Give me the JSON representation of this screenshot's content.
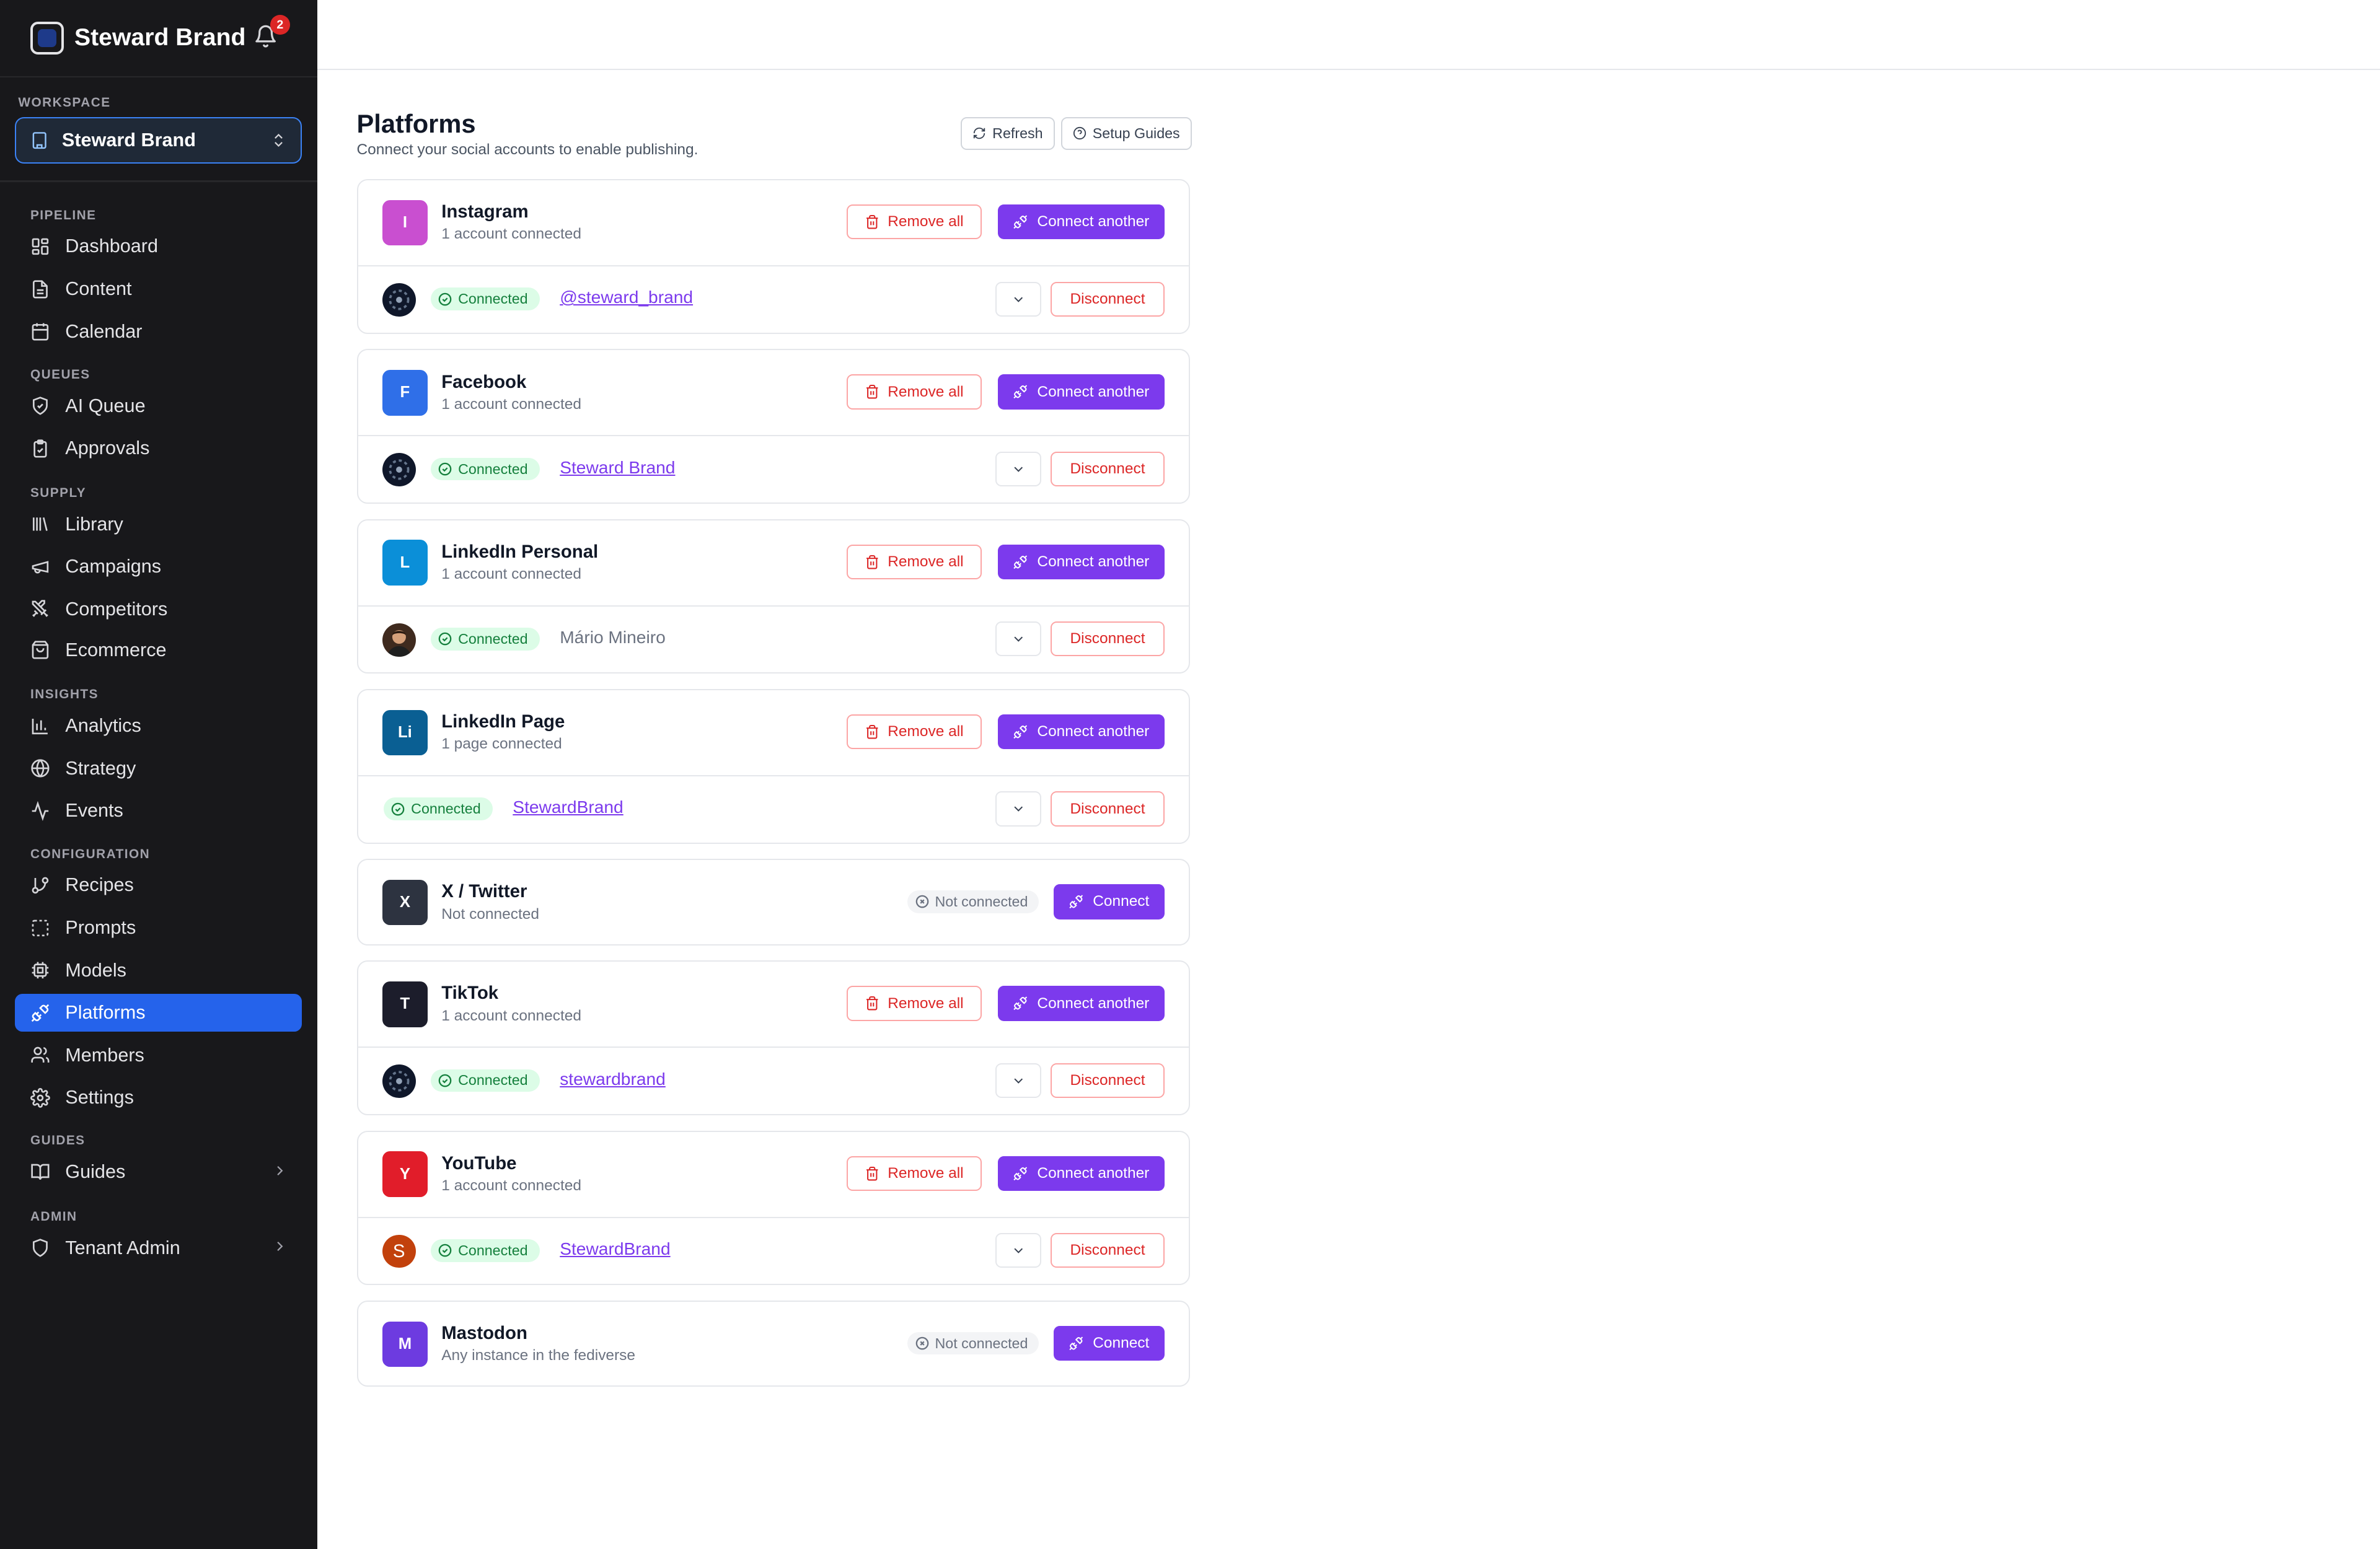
{
  "brand": {
    "name": "Steward Brand",
    "notifications": "2"
  },
  "workspace": {
    "label": "WORKSPACE",
    "name": "Steward Brand"
  },
  "nav": {
    "pipeline": "PIPELINE",
    "dashboard": "Dashboard",
    "content": "Content",
    "calendar": "Calendar",
    "queues": "QUEUES",
    "ai_queue": "AI Queue",
    "approvals": "Approvals",
    "supply": "SUPPLY",
    "library": "Library",
    "campaigns": "Campaigns",
    "competitors": "Competitors",
    "ecommerce": "Ecommerce",
    "insights": "INSIGHTS",
    "analytics": "Analytics",
    "strategy": "Strategy",
    "events": "Events",
    "configuration": "CONFIGURATION",
    "recipes": "Recipes",
    "prompts": "Prompts",
    "models": "Models",
    "platforms": "Platforms",
    "members": "Members",
    "settings": "Settings",
    "guides_section": "GUIDES",
    "guides": "Guides",
    "admin_section": "ADMIN",
    "tenant_admin": "Tenant Admin"
  },
  "header": {
    "title": "Platforms",
    "subtitle": "Connect your social accounts to enable publishing.",
    "refresh": "Refresh",
    "setup_guides": "Setup Guides"
  },
  "labels": {
    "remove_all": "Remove all",
    "connect_another": "Connect another",
    "connect": "Connect",
    "connected": "Connected",
    "not_connected": "Not connected",
    "disconnect": "Disconnect"
  },
  "platforms": [
    {
      "letter": "I",
      "name": "Instagram",
      "status": "1 account connected",
      "color": "#c94fd0",
      "account": "@steward_brand"
    },
    {
      "letter": "F",
      "name": "Facebook",
      "status": "1 account connected",
      "color": "#2f6fe8",
      "account": "Steward Brand"
    },
    {
      "letter": "L",
      "name": "LinkedIn Personal",
      "status": "1 account connected",
      "color": "#0b8fd8",
      "account": "Mário Mineiro"
    },
    {
      "letter": "Li",
      "name": "LinkedIn Page",
      "status": "1 page connected",
      "color": "#0a5f93",
      "account": "StewardBrand"
    },
    {
      "letter": "X",
      "name": "X / Twitter",
      "status": "Not connected",
      "color": "#1f2937"
    },
    {
      "letter": "T",
      "name": "TikTok",
      "status": "1 account connected",
      "color": "#111827",
      "account": "stewardbrand"
    },
    {
      "letter": "Y",
      "name": "YouTube",
      "status": "1 account connected",
      "color": "#e11d2a",
      "account": "StewardBrand",
      "avatar_letter": "S"
    },
    {
      "letter": "M",
      "name": "Mastodon",
      "status": "Any instance in the fediverse",
      "color": "#6d3be0"
    }
  ]
}
